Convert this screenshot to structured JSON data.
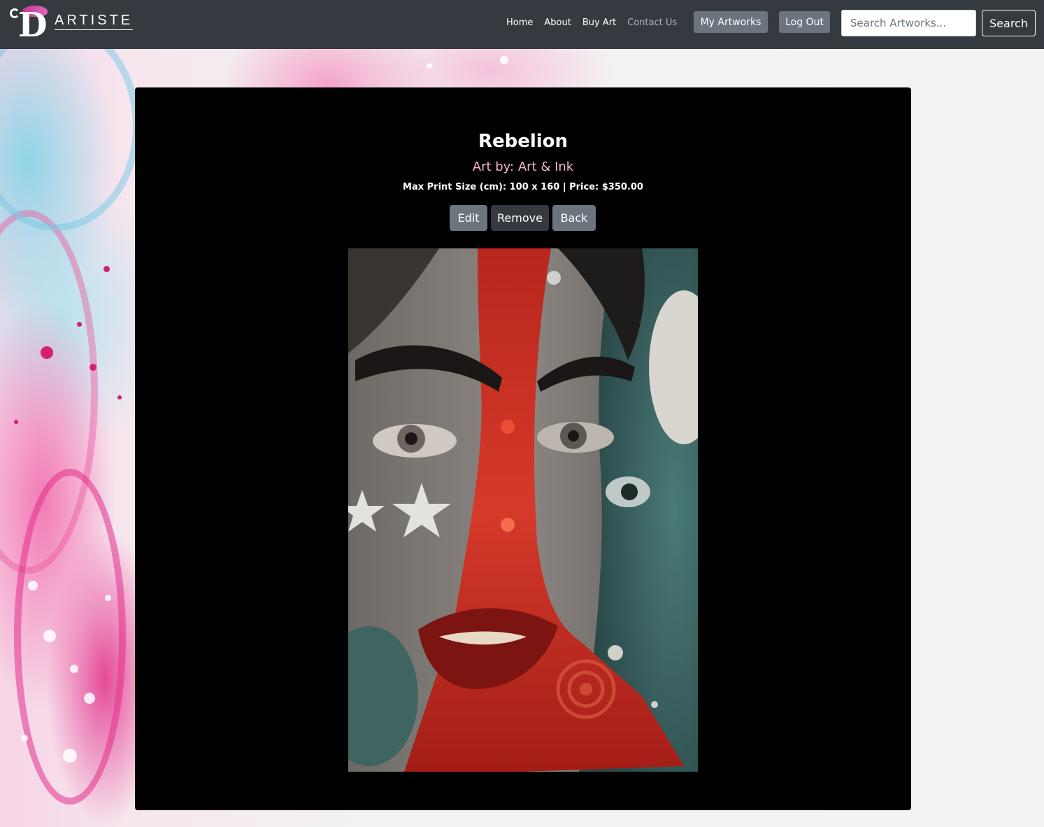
{
  "brand": {
    "logo_text": "ARTISTE",
    "logo_letter": "D"
  },
  "nav": {
    "links": [
      "Home",
      "About",
      "Buy Art",
      "Contact Us"
    ],
    "my_artworks": "My Artworks",
    "log_out": "Log Out",
    "search_placeholder": "Search Artworks...",
    "search_label": "Search"
  },
  "artwork": {
    "title": "Rebelion",
    "artist_prefix": "Art by: ",
    "artist": "Art & Ink",
    "meta": "Max Print Size (cm): 100 x 160 | Price: $350.00",
    "image_alt": "Rebelion"
  },
  "actions": {
    "edit": "Edit",
    "remove": "Remove",
    "back": "Back"
  },
  "colors": {
    "navbar": "#343a40",
    "button_gray": "#6c757d",
    "button_dark": "#343a40",
    "artist_pink": "#f7b6c6",
    "card": "#000000"
  }
}
